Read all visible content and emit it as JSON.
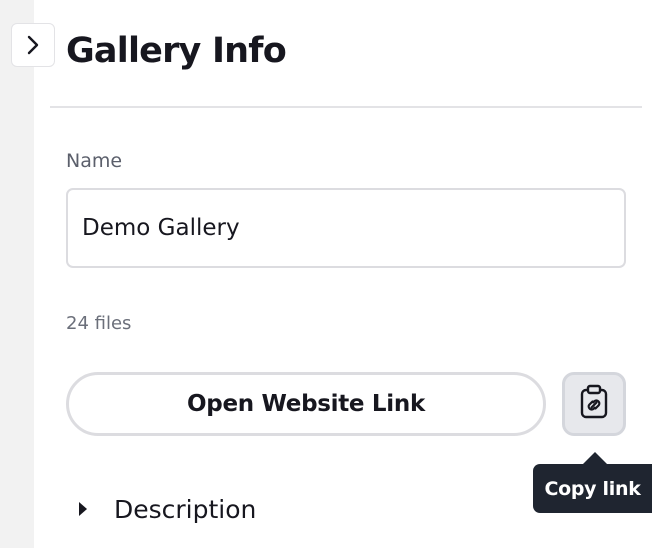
{
  "panel": {
    "title": "Gallery Info"
  },
  "name_field": {
    "label": "Name",
    "value": "Demo Gallery"
  },
  "file_count": "24 files",
  "actions": {
    "open_website_link": "Open Website Link",
    "copy_link_tooltip": "Copy link"
  },
  "description": {
    "label": "Description",
    "expanded": false
  },
  "icons": {
    "collapse": "chevron-right-icon",
    "copy": "clipboard-link-icon",
    "description_toggle": "caret-right-icon"
  }
}
